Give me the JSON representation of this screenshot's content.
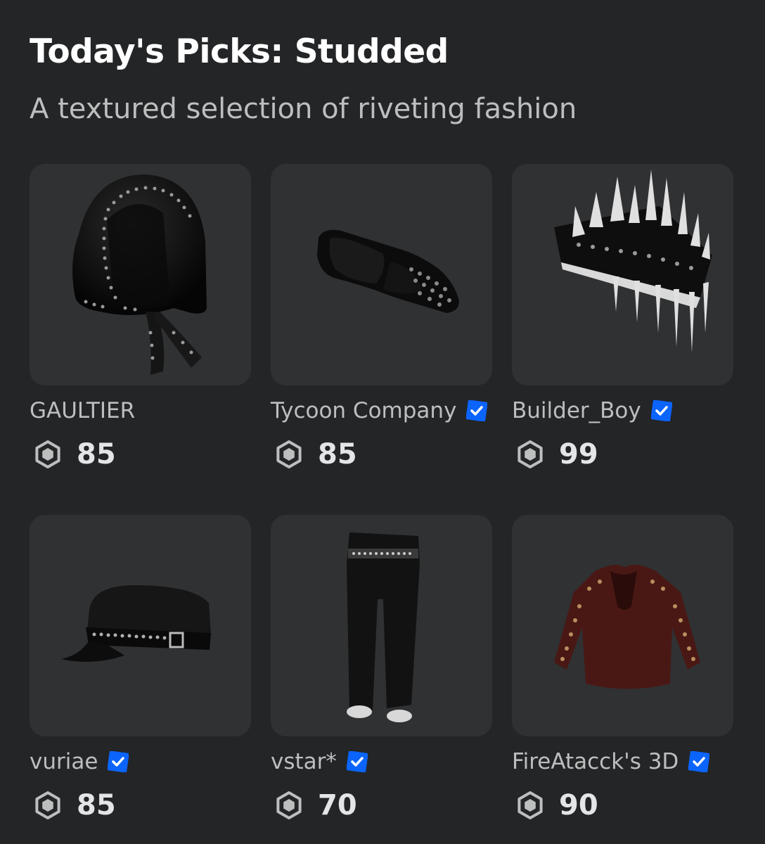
{
  "header": {
    "title": "Today's Picks: Studded",
    "subtitle": "A textured selection of riveting fashion"
  },
  "items": [
    {
      "creator": "GAULTIER",
      "verified": false,
      "price": "85",
      "icon": "studded-hood-headscarf"
    },
    {
      "creator": "Tycoon Company",
      "verified": true,
      "price": "85",
      "icon": "studded-sunglasses"
    },
    {
      "creator": "Builder_Boy",
      "verified": true,
      "price": "99",
      "icon": "spiked-hat"
    },
    {
      "creator": "vuriae",
      "verified": true,
      "price": "85",
      "icon": "studded-cap"
    },
    {
      "creator": "vstar*",
      "verified": true,
      "price": "70",
      "icon": "studded-pants"
    },
    {
      "creator": "FireAtacck's 3D",
      "verified": true,
      "price": "90",
      "icon": "studded-leather-jacket"
    }
  ],
  "colors": {
    "background": "#232527",
    "card": "#2f3133",
    "verified": "#0b64fb",
    "secondary_text": "#bdbebe"
  }
}
